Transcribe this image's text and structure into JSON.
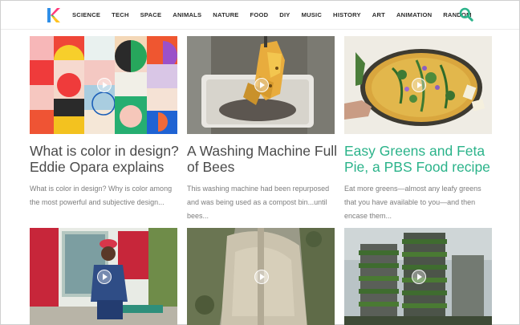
{
  "nav": {
    "items": [
      "SCIENCE",
      "TECH",
      "SPACE",
      "ANIMALS",
      "NATURE",
      "FOOD",
      "DIY",
      "MUSIC",
      "HISTORY",
      "ART",
      "ANIMATION",
      "RANDOM"
    ]
  },
  "colors": {
    "accent_green": "#2bb38a",
    "logo_pink": "#ff3b7a",
    "logo_blue": "#2f8fe8",
    "logo_yellow": "#ffc21f"
  },
  "icons": {
    "logo": "k-logo-icon",
    "search": "search-icon",
    "play": "play-icon"
  },
  "cards": [
    {
      "title": "What is color in design? Eddie Opara explains",
      "excerpt": "What is color in design? Why is color among the most powerful and subjective design..."
    },
    {
      "title": "A Washing Machine Full of Bees",
      "excerpt": "This washing machine had been repurposed and was being used as a compost bin...until bees..."
    },
    {
      "title": "Easy Greens and Feta Pie, a PBS Food recipe",
      "excerpt": "Eat more greens—almost any leafy greens that you have available to you—and then encase them..."
    }
  ]
}
